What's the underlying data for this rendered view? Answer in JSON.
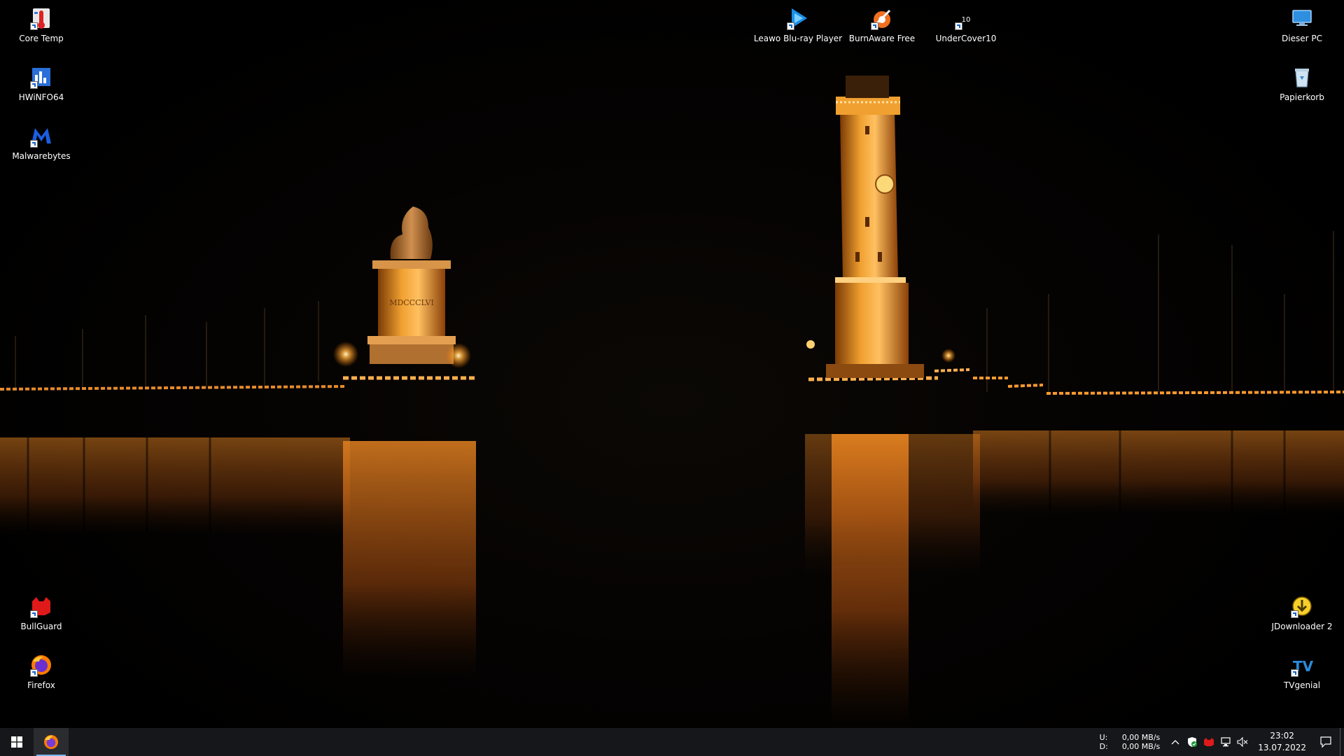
{
  "desktop": {
    "icons": [
      {
        "label": "Core Temp",
        "icon": "core-temp-icon"
      },
      {
        "label": "HWiNFO64",
        "icon": "hwinfo-icon"
      },
      {
        "label": "Malwarebytes",
        "icon": "malwarebytes-icon"
      },
      {
        "label": "Leawo Blu-ray Player",
        "icon": "leawo-icon"
      },
      {
        "label": "BurnAware Free",
        "icon": "burnaware-icon"
      },
      {
        "label": "UnderCover10",
        "icon": "undercover-icon"
      },
      {
        "label": "Dieser PC",
        "icon": "this-pc-icon"
      },
      {
        "label": "Papierkorb",
        "icon": "recycle-bin-icon"
      },
      {
        "label": "BullGuard",
        "icon": "bullguard-icon"
      },
      {
        "label": "Firefox",
        "icon": "firefox-icon"
      },
      {
        "label": "JDownloader 2",
        "icon": "jdownloader-icon"
      },
      {
        "label": "TVgenial",
        "icon": "tvgenial-icon"
      }
    ]
  },
  "taskbar": {
    "start_icon": "windows-logo-icon",
    "pinned_app": "firefox-icon",
    "network": {
      "upload_label": "U:",
      "download_label": "D:",
      "upload_value": "0,00 MB/s",
      "download_value": "0,00 MB/s"
    },
    "clock": {
      "time": "23:02",
      "date": "13.07.2022"
    },
    "tray_icons": [
      "chevron-up-icon",
      "security-shield-icon",
      "bullguard-tray-icon",
      "network-icon",
      "volume-muted-icon"
    ],
    "notification_icon": "action-center-icon"
  },
  "colors": {
    "taskbar_bg": "#16171a",
    "accent": "#7ab6ee",
    "glow": "#ffa030"
  }
}
